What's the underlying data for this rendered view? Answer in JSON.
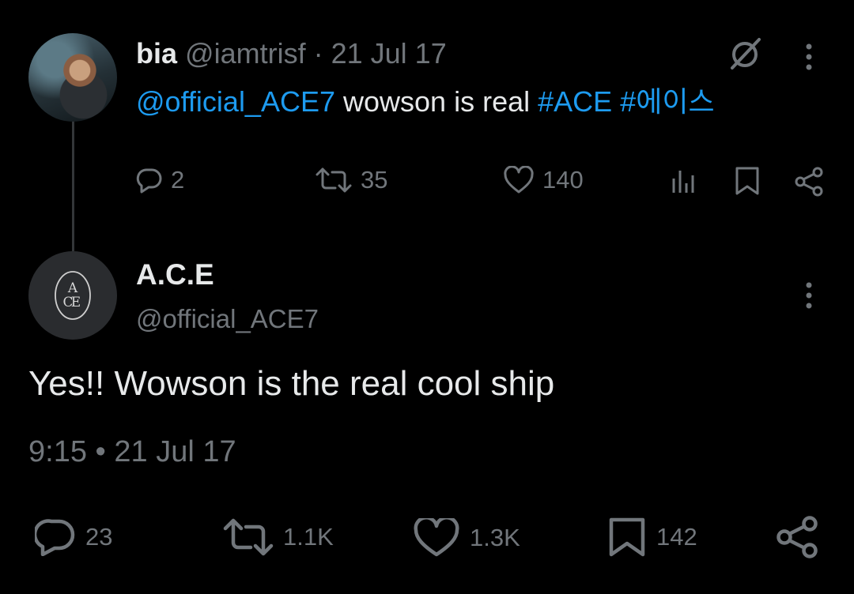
{
  "parent_tweet": {
    "display_name": "bia",
    "handle": "@iamtrisf",
    "separator": "·",
    "date": "21 Jul 17",
    "text": {
      "mention": "@official_ACE7",
      "body": "wowson is real",
      "hashtag1": "#ACE",
      "hashtag2": "#에이스"
    },
    "actions": {
      "replies": "2",
      "retweets": "35",
      "likes": "140"
    },
    "icons": [
      "grok-icon",
      "more-icon",
      "reply-icon",
      "retweet-icon",
      "like-icon",
      "views-icon",
      "bookmark-icon",
      "share-icon"
    ]
  },
  "main_tweet": {
    "display_name": "A.C.E",
    "handle": "@official_ACE7",
    "text": "Yes!! Wowson is the real cool ship",
    "timestamp": "9:15 • 21 Jul 17",
    "actions": {
      "replies": "23",
      "retweets": "1.1K",
      "likes": "1.3K",
      "bookmarks": "142"
    }
  },
  "colors": {
    "background": "#000000",
    "text": "#e7e9ea",
    "muted": "#71767b",
    "link": "#1d9bf0",
    "thread_line": "#333639"
  }
}
